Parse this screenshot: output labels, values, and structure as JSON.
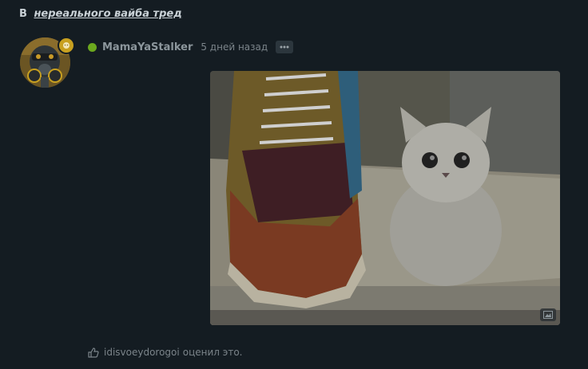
{
  "thread": {
    "prefix": "В",
    "title": "нереального вайба тред"
  },
  "post": {
    "username": "MamaYaStalker",
    "time": "5 дней назад",
    "online_color": "#6ca81e",
    "more_icon": "ellipsis-icon",
    "image_alt": "shoe-and-kitten-photo"
  },
  "reactions": {
    "icon": "thumbs-up-icon",
    "user": "idisvoeydorogoi",
    "suffix": "оценил это."
  }
}
